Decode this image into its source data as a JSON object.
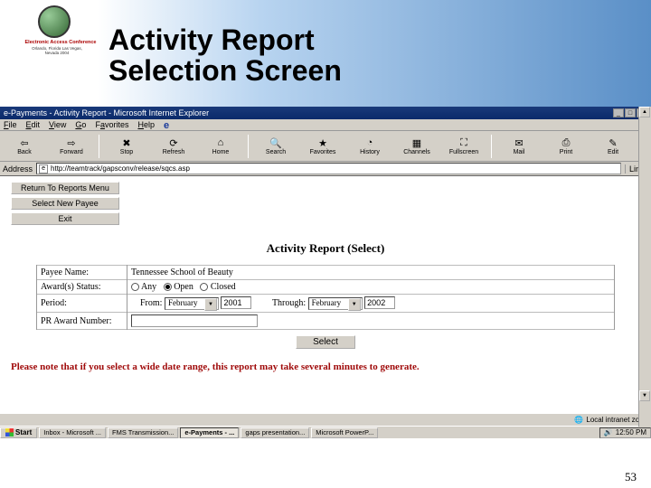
{
  "logo": {
    "conference": "Electronic Access Conference",
    "location": "Orlando, Florida\nLas Vegas, Nevada",
    "year": "2004"
  },
  "slide": {
    "title_line1": "Activity Report",
    "title_line2": "Selection Screen",
    "page_number": "53"
  },
  "window": {
    "title": "e-Payments - Activity Report - Microsoft Internet Explorer",
    "menus": [
      "File",
      "Edit",
      "View",
      "Go",
      "Favorites",
      "Help"
    ],
    "toolbar": [
      {
        "name": "back",
        "label": "Back",
        "icon": "⇦"
      },
      {
        "name": "forward",
        "label": "Forward",
        "icon": "⇨"
      },
      {
        "name": "stop",
        "label": "Stop",
        "icon": "✖"
      },
      {
        "name": "refresh",
        "label": "Refresh",
        "icon": "⟳"
      },
      {
        "name": "home",
        "label": "Home",
        "icon": "⌂"
      },
      {
        "name": "search",
        "label": "Search",
        "icon": "🔍"
      },
      {
        "name": "favorites",
        "label": "Favorites",
        "icon": "★"
      },
      {
        "name": "history",
        "label": "History",
        "icon": "◔"
      },
      {
        "name": "channels",
        "label": "Channels",
        "icon": "▦"
      },
      {
        "name": "fullscreen",
        "label": "Fullscreen",
        "icon": "⛶"
      },
      {
        "name": "mail",
        "label": "Mail",
        "icon": "✉"
      },
      {
        "name": "print",
        "label": "Print",
        "icon": "⎙"
      },
      {
        "name": "edit",
        "label": "Edit",
        "icon": "✎"
      }
    ],
    "address_label": "Address",
    "address_url": "http://teamtrack/gapsconv/release/sqcs.asp",
    "links_label": "Links"
  },
  "page_body": {
    "nav_buttons": [
      "Return To Reports Menu",
      "Select New Payee",
      "Exit"
    ],
    "form_title": "Activity Report (Select)",
    "fields": {
      "payee_label": "Payee Name:",
      "payee_value": "Tennessee School of Beauty",
      "status_label": "Award(s) Status:",
      "status_options": [
        "Any",
        "Open",
        "Closed"
      ],
      "status_selected": "Open",
      "period_label": "Period:",
      "from_label": "From:",
      "from_month": "February",
      "from_year": "2001",
      "through_label": "Through:",
      "through_month": "February",
      "through_year": "2002",
      "praward_label": "PR Award Number:",
      "praward_value": ""
    },
    "select_button": "Select",
    "warning": "Please note that if you select a wide date range, this report may take several minutes to generate."
  },
  "statusbar": {
    "left": "",
    "zone": "Local intranet zone"
  },
  "taskbar": {
    "start": "Start",
    "tasks": [
      {
        "label": "Inbox - Microsoft ...",
        "active": false
      },
      {
        "label": "FMS Transmission...",
        "active": false
      },
      {
        "label": "e-Payments - ...",
        "active": true
      },
      {
        "label": "gaps presentation...",
        "active": false
      },
      {
        "label": "Microsoft PowerP...",
        "active": false
      }
    ],
    "clock": "12:50 PM"
  }
}
